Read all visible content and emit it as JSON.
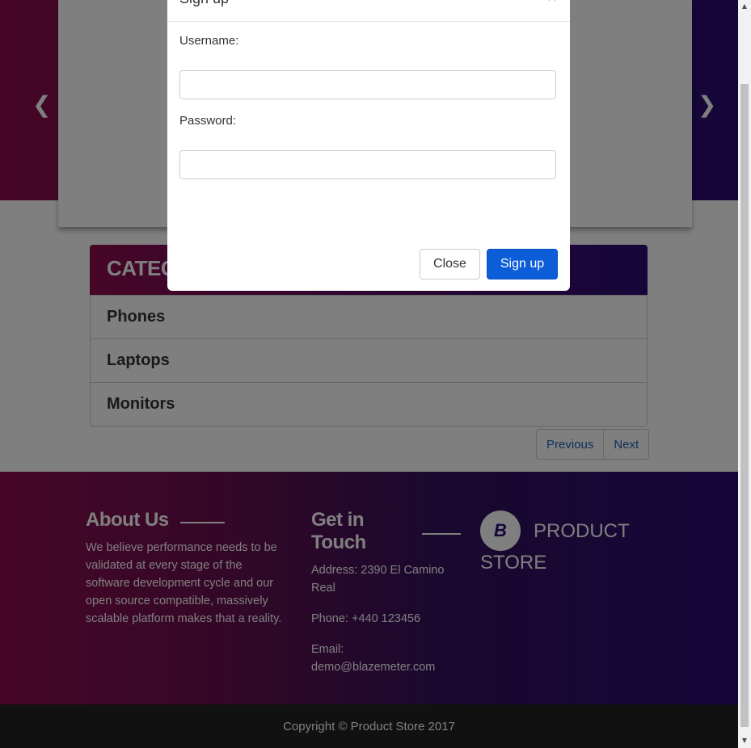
{
  "carousel": {
    "prev_icon": "chevron-left-icon",
    "next_icon": "chevron-right-icon",
    "prev_glyph": "❮",
    "next_glyph": "❯"
  },
  "categories": {
    "title": "CATEGORIES",
    "items": [
      "Phones",
      "Laptops",
      "Monitors"
    ]
  },
  "pagination": {
    "previous": "Previous",
    "next": "Next"
  },
  "footer": {
    "about_title": "About Us",
    "about_text": "We believe performance needs to be validated at every stage of the software development cycle and our open source compatible, massively scalable platform makes that a reality.",
    "contact_title": "Get in Touch",
    "address": "Address: 2390 El Camino Real",
    "phone": "Phone: +440 123456",
    "email": "Email: demo@blazemeter.com",
    "brand_logo_letter": "B",
    "brand_name": "PRODUCT STORE",
    "copyright": "Copyright © Product Store 2017"
  },
  "modal": {
    "title": "Sign up",
    "close_x": "×",
    "username_label": "Username:",
    "password_label": "Password:",
    "username_value": "",
    "password_value": "",
    "close_button": "Close",
    "signup_button": "Sign up"
  },
  "colors": {
    "brand_gradient_start": "#8e0d4d",
    "brand_gradient_end": "#2a0d74",
    "primary_button": "#0b5ed7",
    "link": "#1c63b7",
    "copyright_bg": "#222222"
  }
}
